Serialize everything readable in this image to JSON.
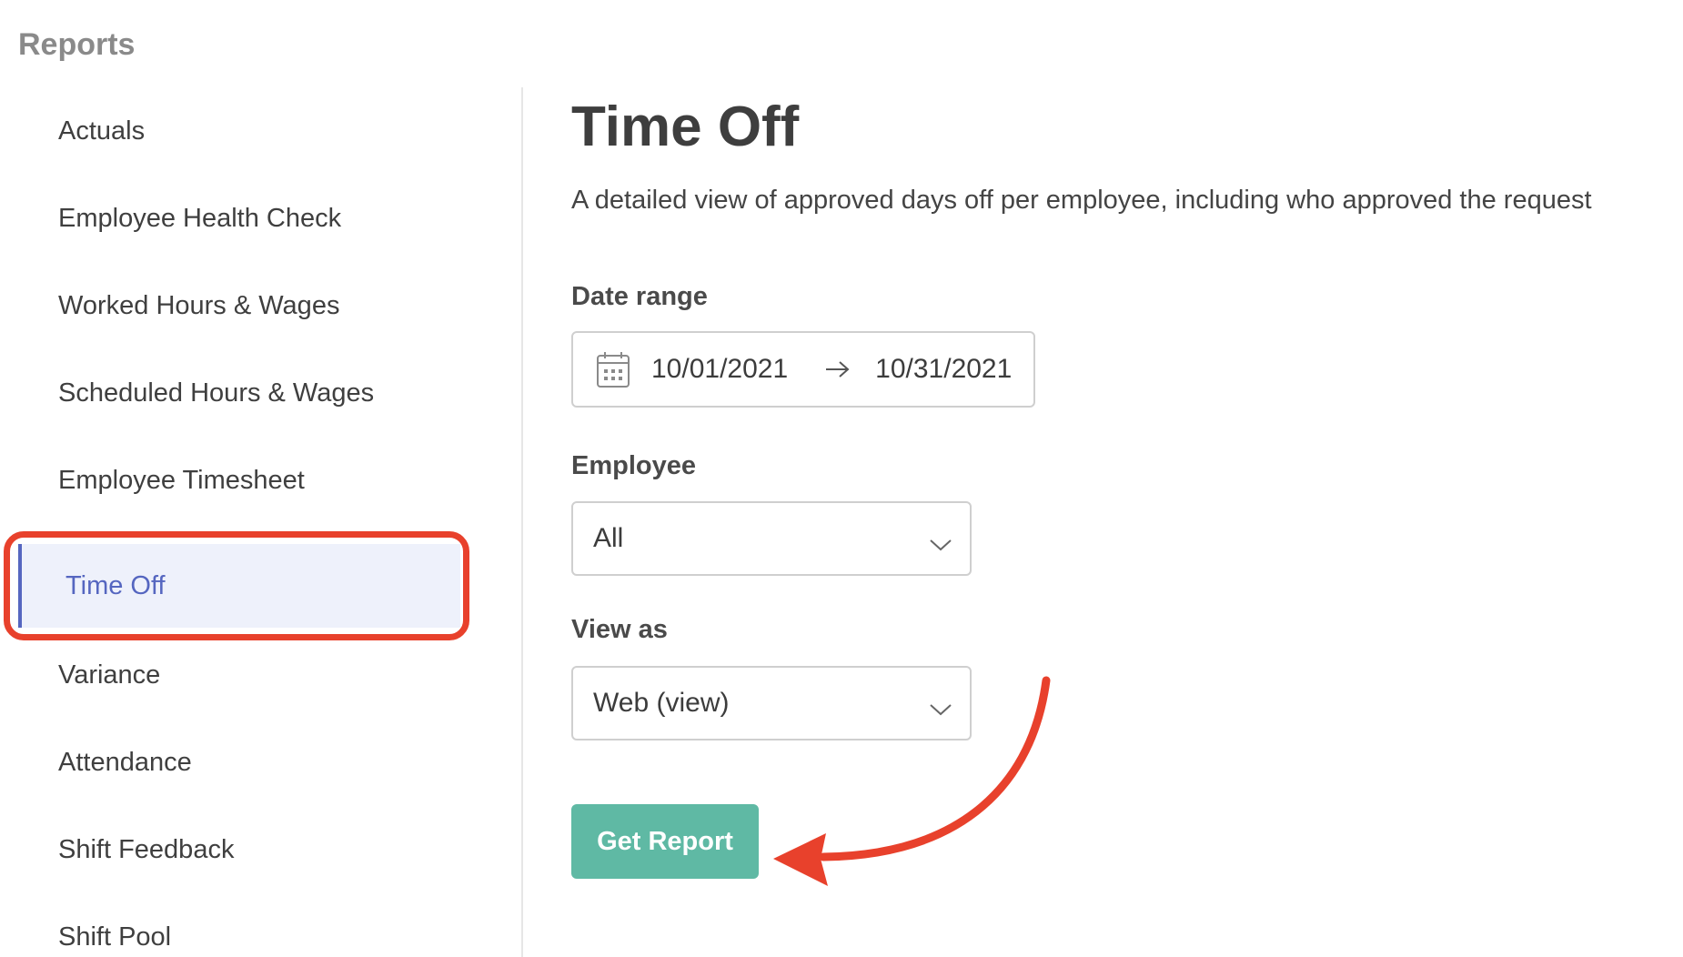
{
  "header": {
    "title": "Reports"
  },
  "sidebar": {
    "items": [
      {
        "label": "Actuals"
      },
      {
        "label": "Employee Health Check"
      },
      {
        "label": "Worked Hours & Wages"
      },
      {
        "label": "Scheduled Hours & Wages"
      },
      {
        "label": "Employee Timesheet"
      },
      {
        "label": "Time Off",
        "active": true
      },
      {
        "label": "Variance"
      },
      {
        "label": "Attendance"
      },
      {
        "label": "Shift Feedback"
      },
      {
        "label": "Shift Pool"
      }
    ]
  },
  "main": {
    "title": "Time Off",
    "description": "A detailed view of approved days off per employee, including who approved the request",
    "date_range": {
      "label": "Date range",
      "start": "10/01/2021",
      "end": "10/31/2021"
    },
    "employee": {
      "label": "Employee",
      "value": "All"
    },
    "view_as": {
      "label": "View as",
      "value": "Web (view)"
    },
    "get_report_label": "Get Report"
  },
  "colors": {
    "accent": "#5566c0",
    "active_bg": "#eef1fb",
    "button": "#5fb9a4",
    "annotation": "#e8412c"
  },
  "icons": {
    "calendar": "calendar-icon",
    "arrow": "arrow-right-icon",
    "chevron": "chevron-down-icon"
  }
}
